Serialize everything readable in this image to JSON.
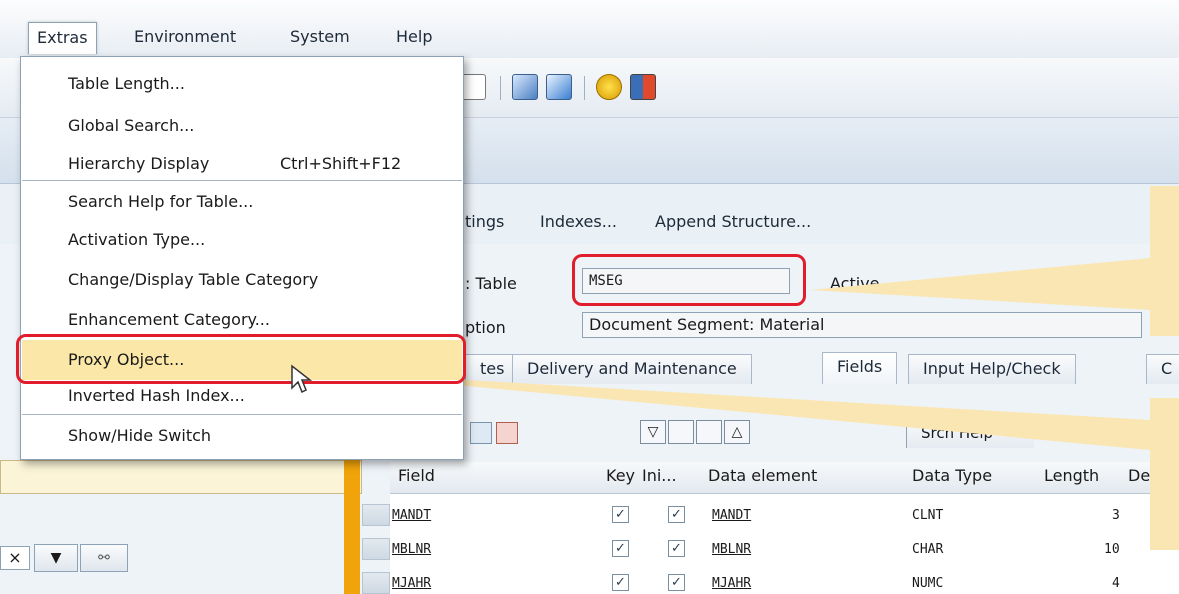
{
  "menubar": {
    "items": [
      "Extras",
      "Environment",
      "System",
      "Help"
    ]
  },
  "extras_menu": {
    "items": [
      {
        "label": "Table Length...",
        "shortcut": ""
      },
      {
        "label": "Global Search...",
        "shortcut": ""
      },
      {
        "label": "Hierarchy Display",
        "shortcut": "Ctrl+Shift+F12"
      },
      {
        "label": "Search Help for Table...",
        "shortcut": ""
      },
      {
        "label": "Activation Type...",
        "shortcut": ""
      },
      {
        "label": "Change/Display Table Category",
        "shortcut": ""
      },
      {
        "label": "Enhancement Category...",
        "shortcut": ""
      },
      {
        "label": "Proxy Object...",
        "shortcut": ""
      },
      {
        "label": "Inverted Hash Index...",
        "shortcut": ""
      },
      {
        "label": "Show/Hide Switch",
        "shortcut": ""
      }
    ]
  },
  "app_toolbar": {
    "settings_partial": "tings",
    "indexes": "Indexes...",
    "append_structure": "Append Structure..."
  },
  "header_fields": {
    "table_label_partial": ": Table",
    "table_value": "MSEG",
    "status": "Active",
    "description_label_partial": "ption",
    "description_value": "Document Segment: Material"
  },
  "tabs": [
    "tes",
    "Delivery and Maintenance",
    "Fields",
    "Input Help/Check",
    "C"
  ],
  "table_toolbar": {
    "srch_help": "Srch Help"
  },
  "fields_table": {
    "columns": [
      "Field",
      "Key",
      "Ini...",
      "Data element",
      "Data Type",
      "Length",
      "De"
    ],
    "rows": [
      {
        "field": "MANDT",
        "key": "✓",
        "ini": "✓",
        "data_element": "MANDT",
        "data_type": "CLNT",
        "length": "3"
      },
      {
        "field": "MBLNR",
        "key": "✓",
        "ini": "✓",
        "data_element": "MBLNR",
        "data_type": "CHAR",
        "length": "10"
      },
      {
        "field": "MJAHR",
        "key": "✓",
        "ini": "✓",
        "data_element": "MJAHR",
        "data_type": "NUMC",
        "length": "4"
      }
    ]
  },
  "colors": {
    "highlight_red": "#e11d2c",
    "callout_yellow": "#fae6b3",
    "menu_highlight": "#fbe7a8",
    "orange_bar": "#f0a30a"
  }
}
